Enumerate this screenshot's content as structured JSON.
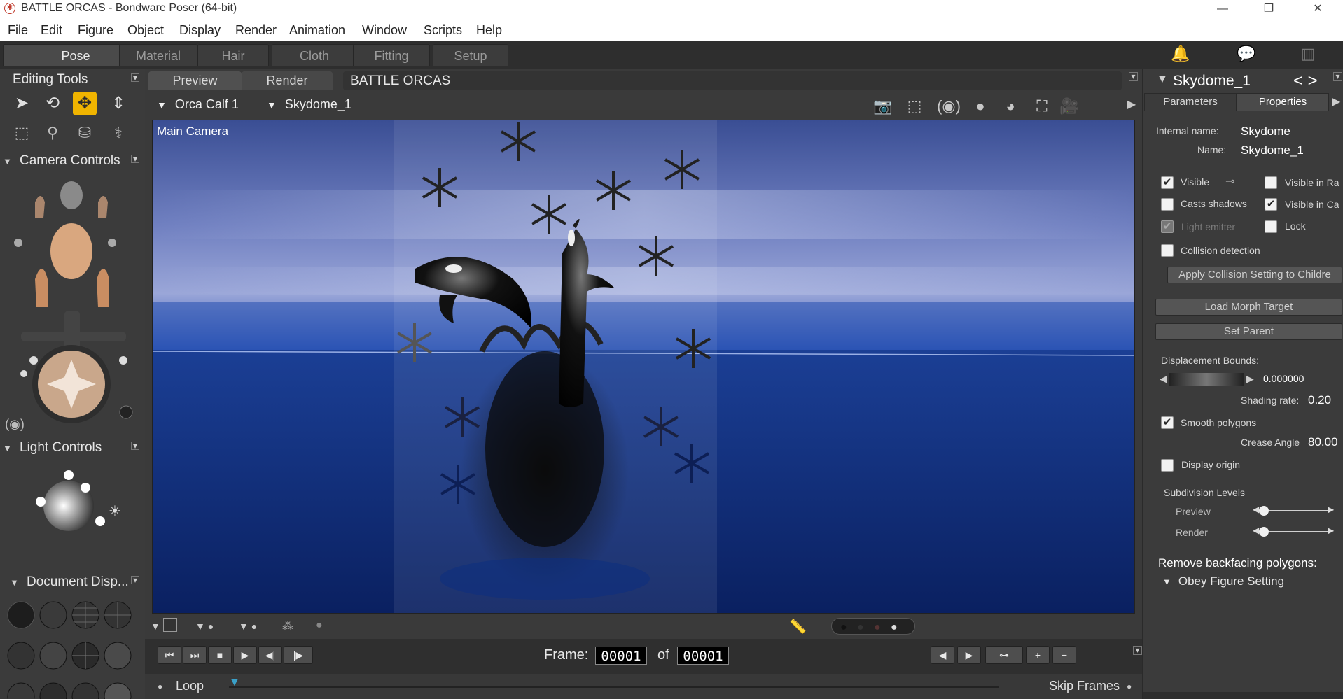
{
  "window": {
    "title": "BATTLE ORCAS - Bondware Poser (64-bit)",
    "minimize": "—",
    "restore": "❐",
    "close": "✕"
  },
  "menu": [
    "File",
    "Edit",
    "Figure",
    "Object",
    "Display",
    "Render",
    "Animation",
    "Window",
    "Scripts",
    "Help"
  ],
  "rooms": [
    "Pose",
    "Material",
    "Hair",
    "Cloth",
    "Fitting",
    "Setup"
  ],
  "left": {
    "editing_tools": "Editing Tools",
    "camera_controls": "Camera Controls",
    "light_controls": "Light Controls",
    "document_display": "Document  Disp..."
  },
  "doc": {
    "tabs": [
      "Preview",
      "Render"
    ],
    "name": "BATTLE ORCAS",
    "actor": "Orca Calf 1",
    "figure": "Skydome_1",
    "camera": "Main Camera"
  },
  "playback": {
    "frame_label": "Frame:",
    "current_frame": "00001",
    "of_label": "of",
    "total_frames": "00001",
    "loop": "Loop",
    "skip_frames": "Skip Frames"
  },
  "right": {
    "title": "Skydome_1",
    "nav": "< >",
    "tabs": [
      "Parameters",
      "Properties"
    ],
    "internal_name_label": "Internal name:",
    "internal_name": "Skydome",
    "name_label": "Name:",
    "name": "Skydome_1",
    "visible": "Visible",
    "visible_in_render": "Visible in Ra",
    "casts_shadows": "Casts shadows",
    "visible_in_camera": "Visible in Ca",
    "light_emitter": "Light emitter",
    "lock": "Lock",
    "collision_detection": "Collision detection",
    "apply_collision": "Apply Collision Setting to Childre",
    "load_morph": "Load Morph Target",
    "set_parent": "Set Parent",
    "displacement_bounds": "Displacement Bounds:",
    "displacement_value": "0.000000",
    "shading_rate_label": "Shading rate:",
    "shading_rate": "0.20",
    "smooth_polygons": "Smooth polygons",
    "crease_angle_label": "Crease Angle",
    "crease_angle": "80.00",
    "display_origin": "Display origin",
    "subdivision_levels": "Subdivision Levels",
    "preview": "Preview",
    "render": "Render",
    "remove_backfacing": "Remove backfacing polygons:",
    "obey_figure": "Obey Figure Setting"
  },
  "colors": {
    "accent": "#f0b400",
    "sky_top": "#3a4e94",
    "sea": "#0c2a6e"
  }
}
